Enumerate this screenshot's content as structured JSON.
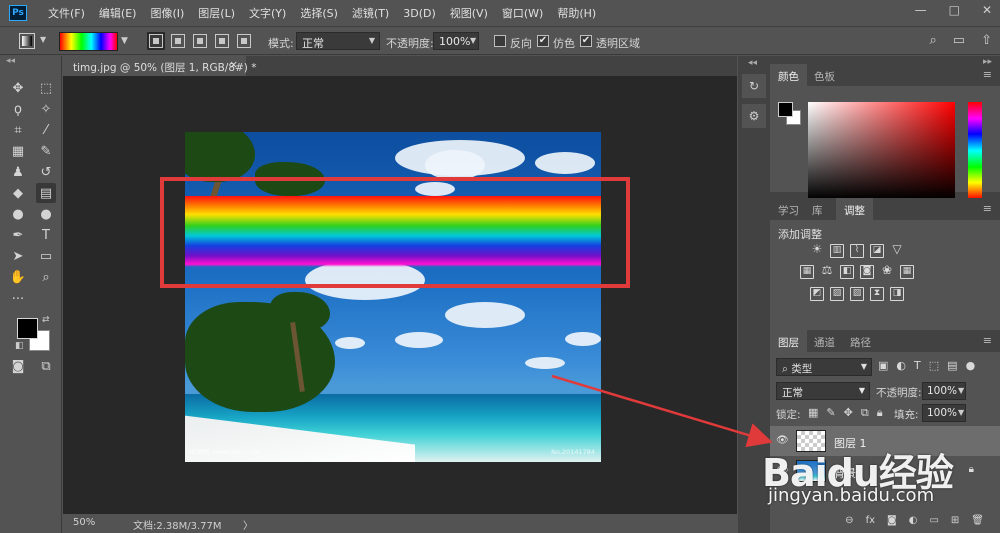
{
  "app": {
    "logo": "Ps",
    "menus": [
      "文件(F)",
      "编辑(E)",
      "图像(I)",
      "图层(L)",
      "文字(Y)",
      "选择(S)",
      "滤镜(T)",
      "3D(D)",
      "视图(V)",
      "窗口(W)",
      "帮助(H)"
    ],
    "window_controls": [
      "minimize-icon",
      "maximize-icon",
      "close-icon"
    ]
  },
  "options": {
    "mode_label": "模式:",
    "mode_value": "正常",
    "opacity_label": "不透明度:",
    "opacity_value": "100%",
    "reverse_label": "反向",
    "reverse_checked": false,
    "dither_label": "仿色",
    "dither_checked": true,
    "transparency_label": "透明区域",
    "transparency_checked": true,
    "gradient_types": [
      "linear",
      "radial",
      "angle",
      "reflected",
      "diamond"
    ],
    "active_gradient_type": "linear",
    "right_icons": [
      "search-icon",
      "workspace-icon",
      "share-icon"
    ]
  },
  "document": {
    "tab_title": "timg.jpg @ 50% (图层 1, RGB/8#) *",
    "tab_close": "×",
    "image_watermark": "昵图网 www.nipic.com",
    "image_id": "No.20141784",
    "zoom": "50%",
    "doc_info": "文档:2.38M/3.77M",
    "status_arrow": "〉"
  },
  "colors": {
    "foreground": "#000000",
    "background": "#ffffff",
    "accent_red": "#e03a3a",
    "gradient_stops": [
      "#ff1010",
      "#ff8000",
      "#ffe000",
      "#30d020",
      "#00c8d8",
      "#1440e0",
      "#7010c8",
      "#ff10d0"
    ]
  },
  "panels": {
    "color_tabs": [
      "颜色",
      "色板"
    ],
    "adjust_tabs": [
      "学习",
      "库",
      "调整"
    ],
    "adjust_title": "添加调整",
    "layers_tabs": [
      "图层",
      "通道",
      "路径"
    ],
    "layer_filter": "类型",
    "blend_mode": "正常",
    "opacity_label": "不透明度:",
    "opacity_value": "100%",
    "lock_label": "锁定:",
    "fill_label": "填充:",
    "fill_value": "100%",
    "layers": [
      {
        "name": "图层 1",
        "selected": true,
        "visible": true,
        "thumb": "transparent"
      },
      {
        "name": "背景",
        "selected": false,
        "visible": true,
        "thumb": "photo",
        "locked": true
      }
    ]
  },
  "watermark": {
    "brand": "Baidu经验",
    "url": "jingyan.baidu.com"
  }
}
